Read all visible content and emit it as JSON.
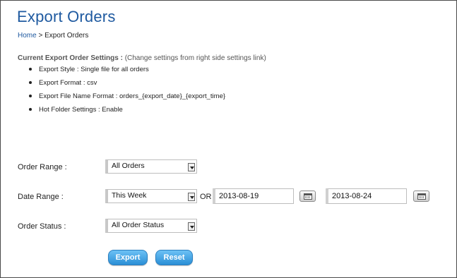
{
  "page": {
    "title": "Export Orders"
  },
  "breadcrumb": {
    "home": "Home",
    "separator": ">",
    "current": "Export Orders"
  },
  "settings": {
    "heading": "Current Export Order Settings :",
    "note": "(Change settings from right side settings link)",
    "items": [
      "Export Style : Single file for all orders",
      "Export Format : csv",
      "Export File Name Format : orders_{export_date}_{export_time}",
      "Hot Folder Settings : Enable"
    ]
  },
  "form": {
    "order_range": {
      "label": "Order Range :",
      "value": "All Orders"
    },
    "date_range": {
      "label": "Date Range :",
      "preset": "This Week",
      "or_text": "OR",
      "from_date": "2013-08-19",
      "to_date": "2013-08-24"
    },
    "order_status": {
      "label": "Order Status :",
      "value": "All Order Status"
    }
  },
  "actions": {
    "export_label": "Export",
    "reset_label": "Reset"
  },
  "icons": {
    "dropdown": "chevron-down-icon",
    "calendar": "calendar-icon"
  },
  "colors": {
    "title": "#1f5aa0",
    "button": "#2b8fd6",
    "link": "#1f5aa0"
  }
}
